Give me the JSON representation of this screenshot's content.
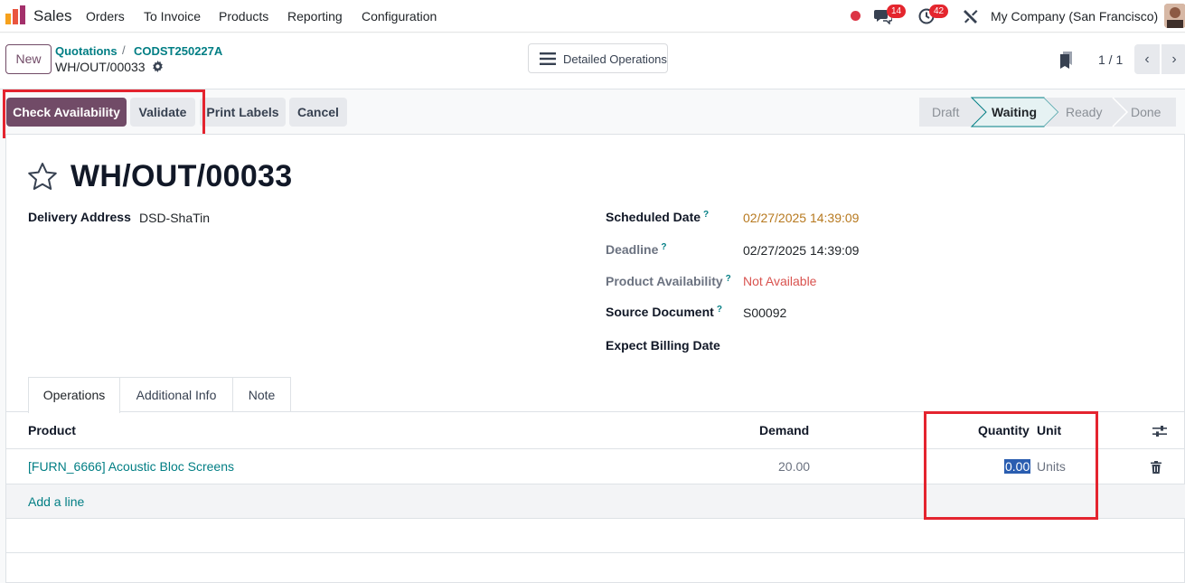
{
  "navbar": {
    "app_name": "Sales",
    "menu": [
      "Orders",
      "To Invoice",
      "Products",
      "Reporting",
      "Configuration"
    ],
    "messages_count": "14",
    "activities_count": "42",
    "company": "My Company (San Francisco)"
  },
  "control_panel": {
    "new_label": "New",
    "breadcrumb": [
      "Quotations",
      "CODST250227A"
    ],
    "breadcrumb_separator": "/",
    "record_name": "WH/OUT/00033",
    "detailed_operations_label": "Detailed Operations",
    "pager": "1 / 1"
  },
  "actions": {
    "check_availability": "Check Availability",
    "validate": "Validate",
    "print_labels": "Print Labels",
    "cancel": "Cancel"
  },
  "stages": {
    "draft": "Draft",
    "waiting": "Waiting",
    "ready": "Ready",
    "done": "Done",
    "active": "Waiting"
  },
  "form": {
    "title": "WH/OUT/00033",
    "delivery_address_label": "Delivery Address",
    "delivery_address": "DSD-ShaTin",
    "scheduled_date_label": "Scheduled Date",
    "scheduled_date": "02/27/2025 14:39:09",
    "deadline_label": "Deadline",
    "deadline": "02/27/2025 14:39:09",
    "product_availability_label": "Product Availability",
    "product_availability": "Not Available",
    "source_document_label": "Source Document",
    "source_document": "S00092",
    "expect_billing_date_label": "Expect Billing Date",
    "help_mark": "?"
  },
  "tabs": [
    "Operations",
    "Additional Info",
    "Note"
  ],
  "table": {
    "headers": {
      "product": "Product",
      "demand": "Demand",
      "quantity": "Quantity",
      "unit": "Unit"
    },
    "rows": [
      {
        "product": "[FURN_6666] Acoustic Bloc Screens",
        "demand": "20.00",
        "quantity": "0.00",
        "unit": "Units"
      }
    ],
    "add_line": "Add a line"
  },
  "colors": {
    "primary": "#714b67",
    "link": "#017e84",
    "warning_date": "#b7791f",
    "danger": "#d9534f",
    "highlight_box": "#e4242f"
  }
}
